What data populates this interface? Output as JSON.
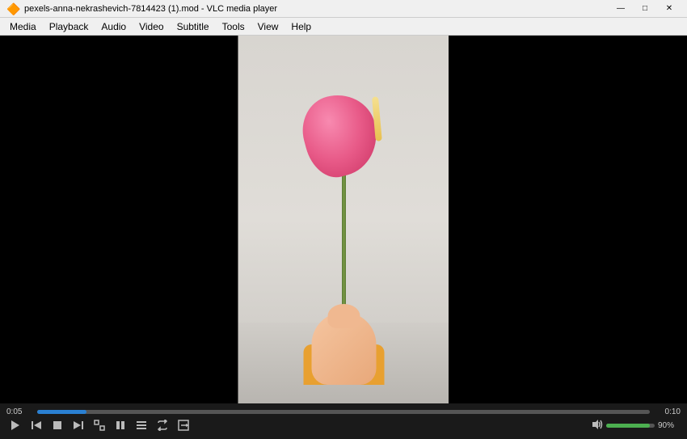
{
  "titleBar": {
    "title": "pexels-anna-nekrashevich-7814423 (1).mod - VLC media player",
    "logo": "🔶",
    "minimizeLabel": "—",
    "maximizeLabel": "□",
    "closeLabel": "✕"
  },
  "menuBar": {
    "items": [
      {
        "label": "Media",
        "id": "media"
      },
      {
        "label": "Playback",
        "id": "playback"
      },
      {
        "label": "Audio",
        "id": "audio"
      },
      {
        "label": "Video",
        "id": "video"
      },
      {
        "label": "Subtitle",
        "id": "subtitle"
      },
      {
        "label": "Tools",
        "id": "tools"
      },
      {
        "label": "View",
        "id": "view"
      },
      {
        "label": "Help",
        "id": "help"
      }
    ]
  },
  "player": {
    "timeStart": "0:05",
    "timeEnd": "0:10",
    "progressPercent": 8,
    "volumePercent": 90,
    "volumeLabel": "90%"
  }
}
